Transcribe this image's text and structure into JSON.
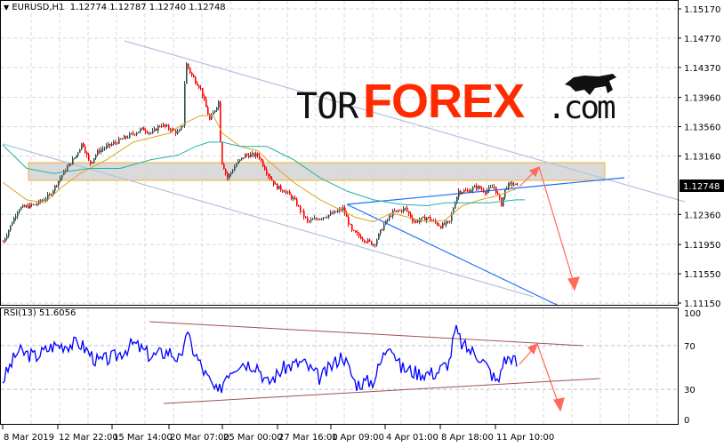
{
  "header": {
    "symbol_info": "EURUSD,H1",
    "ohlc": "1.12774 1.12787 1.12740 1.12748",
    "menu_icon": "triangle-down-icon"
  },
  "rsi": {
    "label": "RSI(13) 51.6056"
  },
  "logo": {
    "part1": "TOR",
    "part2": "FOREX",
    "part3": ".com",
    "icon": "bull-icon",
    "colors": {
      "dark": "#111111",
      "accent": "#ff2a00"
    }
  },
  "colors": {
    "bull": "#2f4f4f",
    "bear": "#ff0000",
    "ma_fast": "#daa520",
    "ma_slow": "#20b2aa",
    "rsi": "#0000ff",
    "channel": "#b0c4de",
    "trend": "#1e6fff",
    "forecast": "#ff6a5a",
    "zone_fill": "#d3d3d3",
    "zone_border": "#f0b429"
  },
  "chart_data": {
    "type": "candlestick",
    "title": "EURUSD,H1",
    "grid": true,
    "current_price": "1.12748",
    "y_ticks": [
      "1.15170",
      "1.14770",
      "1.14370",
      "1.13960",
      "1.13560",
      "1.13160",
      "1.12360",
      "1.11950",
      "1.11550",
      "1.11150"
    ],
    "ylim": [
      1.1115,
      1.1517
    ],
    "x_ticks": [
      "8 Mar 2019",
      "12 Mar 22:00",
      "15 Mar 14:00",
      "20 Mar 07:00",
      "25 Mar 00:00",
      "27 Mar 16:00",
      "1 Apr 09:00",
      "4 Apr 01:00",
      "8 Apr 18:00",
      "11 Apr 10:00"
    ],
    "x_unit": "bar (H1)",
    "close": [
      [
        0,
        1.1199
      ],
      [
        17,
        1.1244
      ],
      [
        37,
        1.125
      ],
      [
        52,
        1.1262
      ],
      [
        67,
        1.1292
      ],
      [
        82,
        1.1317
      ],
      [
        89,
        1.1335
      ],
      [
        97,
        1.1305
      ],
      [
        107,
        1.1323
      ],
      [
        127,
        1.1335
      ],
      [
        147,
        1.1347
      ],
      [
        157,
        1.1353
      ],
      [
        167,
        1.1347
      ],
      [
        177,
        1.1359
      ],
      [
        197,
        1.1347
      ],
      [
        202,
        1.1359
      ],
      [
        205,
        1.1444
      ],
      [
        212,
        1.1426
      ],
      [
        222,
        1.1408
      ],
      [
        232,
        1.1365
      ],
      [
        237,
        1.1377
      ],
      [
        242,
        1.139
      ],
      [
        245,
        1.1311
      ],
      [
        252,
        1.1286
      ],
      [
        262,
        1.1305
      ],
      [
        272,
        1.1317
      ],
      [
        287,
        1.1317
      ],
      [
        297,
        1.1292
      ],
      [
        307,
        1.1274
      ],
      [
        317,
        1.1268
      ],
      [
        327,
        1.1256
      ],
      [
        342,
        1.1226
      ],
      [
        357,
        1.1232
      ],
      [
        372,
        1.1238
      ],
      [
        382,
        1.1244
      ],
      [
        392,
        1.1213
      ],
      [
        407,
        1.1201
      ],
      [
        417,
        1.1195
      ],
      [
        427,
        1.122
      ],
      [
        437,
        1.1238
      ],
      [
        452,
        1.1244
      ],
      [
        462,
        1.1226
      ],
      [
        477,
        1.1232
      ],
      [
        492,
        1.122
      ],
      [
        502,
        1.1226
      ],
      [
        507,
        1.125
      ],
      [
        512,
        1.1268
      ],
      [
        522,
        1.1268
      ],
      [
        532,
        1.1274
      ],
      [
        542,
        1.1268
      ],
      [
        552,
        1.1274
      ],
      [
        560,
        1.125
      ],
      [
        565,
        1.1274
      ],
      [
        572,
        1.1278
      ],
      [
        579,
        1.12748
      ]
    ],
    "ma_fast": [
      [
        0,
        1.128
      ],
      [
        27,
        1.1256
      ],
      [
        47,
        1.1252
      ],
      [
        67,
        1.1274
      ],
      [
        87,
        1.1292
      ],
      [
        117,
        1.1311
      ],
      [
        147,
        1.1335
      ],
      [
        187,
        1.1347
      ],
      [
        202,
        1.1359
      ],
      [
        222,
        1.1371
      ],
      [
        237,
        1.1371
      ],
      [
        247,
        1.1347
      ],
      [
        267,
        1.1329
      ],
      [
        287,
        1.1323
      ],
      [
        297,
        1.1311
      ],
      [
        327,
        1.128
      ],
      [
        357,
        1.1256
      ],
      [
        377,
        1.1244
      ],
      [
        397,
        1.1232
      ],
      [
        417,
        1.1226
      ],
      [
        437,
        1.1238
      ],
      [
        457,
        1.1232
      ],
      [
        477,
        1.1226
      ],
      [
        497,
        1.1228
      ],
      [
        517,
        1.1248
      ],
      [
        537,
        1.1256
      ],
      [
        557,
        1.1262
      ],
      [
        577,
        1.1271
      ]
    ],
    "ma_slow": [
      [
        0,
        1.1331
      ],
      [
        27,
        1.1299
      ],
      [
        57,
        1.1292
      ],
      [
        97,
        1.1299
      ],
      [
        132,
        1.1299
      ],
      [
        167,
        1.1311
      ],
      [
        197,
        1.1317
      ],
      [
        217,
        1.1329
      ],
      [
        232,
        1.1335
      ],
      [
        247,
        1.1335
      ],
      [
        267,
        1.1329
      ],
      [
        297,
        1.1329
      ],
      [
        327,
        1.1311
      ],
      [
        357,
        1.1286
      ],
      [
        387,
        1.1268
      ],
      [
        417,
        1.1256
      ],
      [
        447,
        1.125
      ],
      [
        477,
        1.1248
      ],
      [
        497,
        1.1252
      ],
      [
        517,
        1.1252
      ],
      [
        547,
        1.1252
      ],
      [
        577,
        1.1256
      ],
      [
        587,
        1.1256
      ]
    ],
    "rsi_ticks": [
      "100",
      "70",
      "30",
      "0"
    ],
    "rsi_levels": [
      70,
      30
    ],
    "rsi_values": [
      [
        0,
        38
      ],
      [
        17,
        65
      ],
      [
        37,
        60
      ],
      [
        57,
        70
      ],
      [
        87,
        72
      ],
      [
        107,
        55
      ],
      [
        127,
        60
      ],
      [
        147,
        72
      ],
      [
        167,
        60
      ],
      [
        187,
        65
      ],
      [
        202,
        55
      ],
      [
        205,
        85
      ],
      [
        212,
        70
      ],
      [
        227,
        45
      ],
      [
        242,
        25
      ],
      [
        252,
        45
      ],
      [
        267,
        55
      ],
      [
        287,
        52
      ],
      [
        297,
        35
      ],
      [
        317,
        50
      ],
      [
        337,
        55
      ],
      [
        357,
        40
      ],
      [
        382,
        62
      ],
      [
        397,
        35
      ],
      [
        417,
        38
      ],
      [
        435,
        75
      ],
      [
        447,
        50
      ],
      [
        467,
        45
      ],
      [
        487,
        45
      ],
      [
        502,
        55
      ],
      [
        509,
        85
      ],
      [
        517,
        70
      ],
      [
        537,
        60
      ],
      [
        557,
        35
      ],
      [
        562,
        55
      ],
      [
        572,
        60
      ],
      [
        579,
        52
      ]
    ]
  }
}
